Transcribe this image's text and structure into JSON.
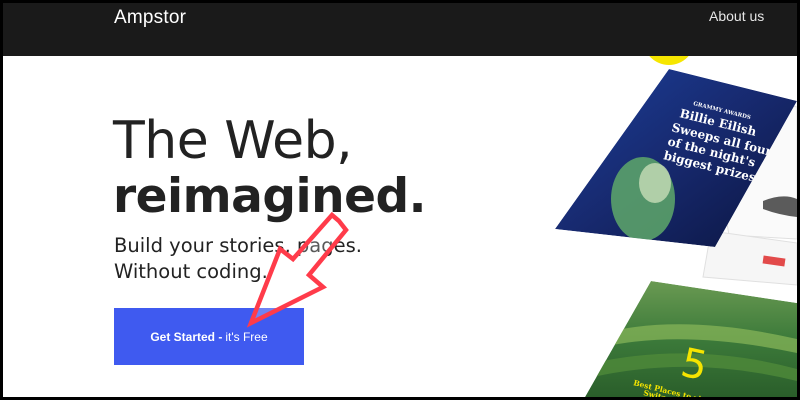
{
  "nav": {
    "brand": "Ampstor",
    "about_label": "About us"
  },
  "hero": {
    "headline_line1": "The Web,",
    "headline_line2": "reimagined.",
    "subhead_line1": "Build your stories,        pages.",
    "subhead_line2": "Without coding."
  },
  "cta": {
    "label_bold": "Get Started -",
    "label_rest": "it's Free"
  },
  "story_cards": {
    "grammy_kicker": "GRAMMY AWARDS",
    "grammy_title_l1": "Billie Eilish",
    "grammy_title_l2": "Sweeps all four",
    "grammy_title_l3": "of the night's",
    "grammy_title_l4": "biggest prizes",
    "travel_number": "5",
    "travel_title_l1": "Best Places to visit in",
    "travel_title_l2": "Switzerland"
  },
  "colors": {
    "navbar": "#1a1a1a",
    "cta_background": "#3f5af0",
    "annotation_arrow": "#ff3b4a",
    "accent_yellow": "#f6e600"
  }
}
